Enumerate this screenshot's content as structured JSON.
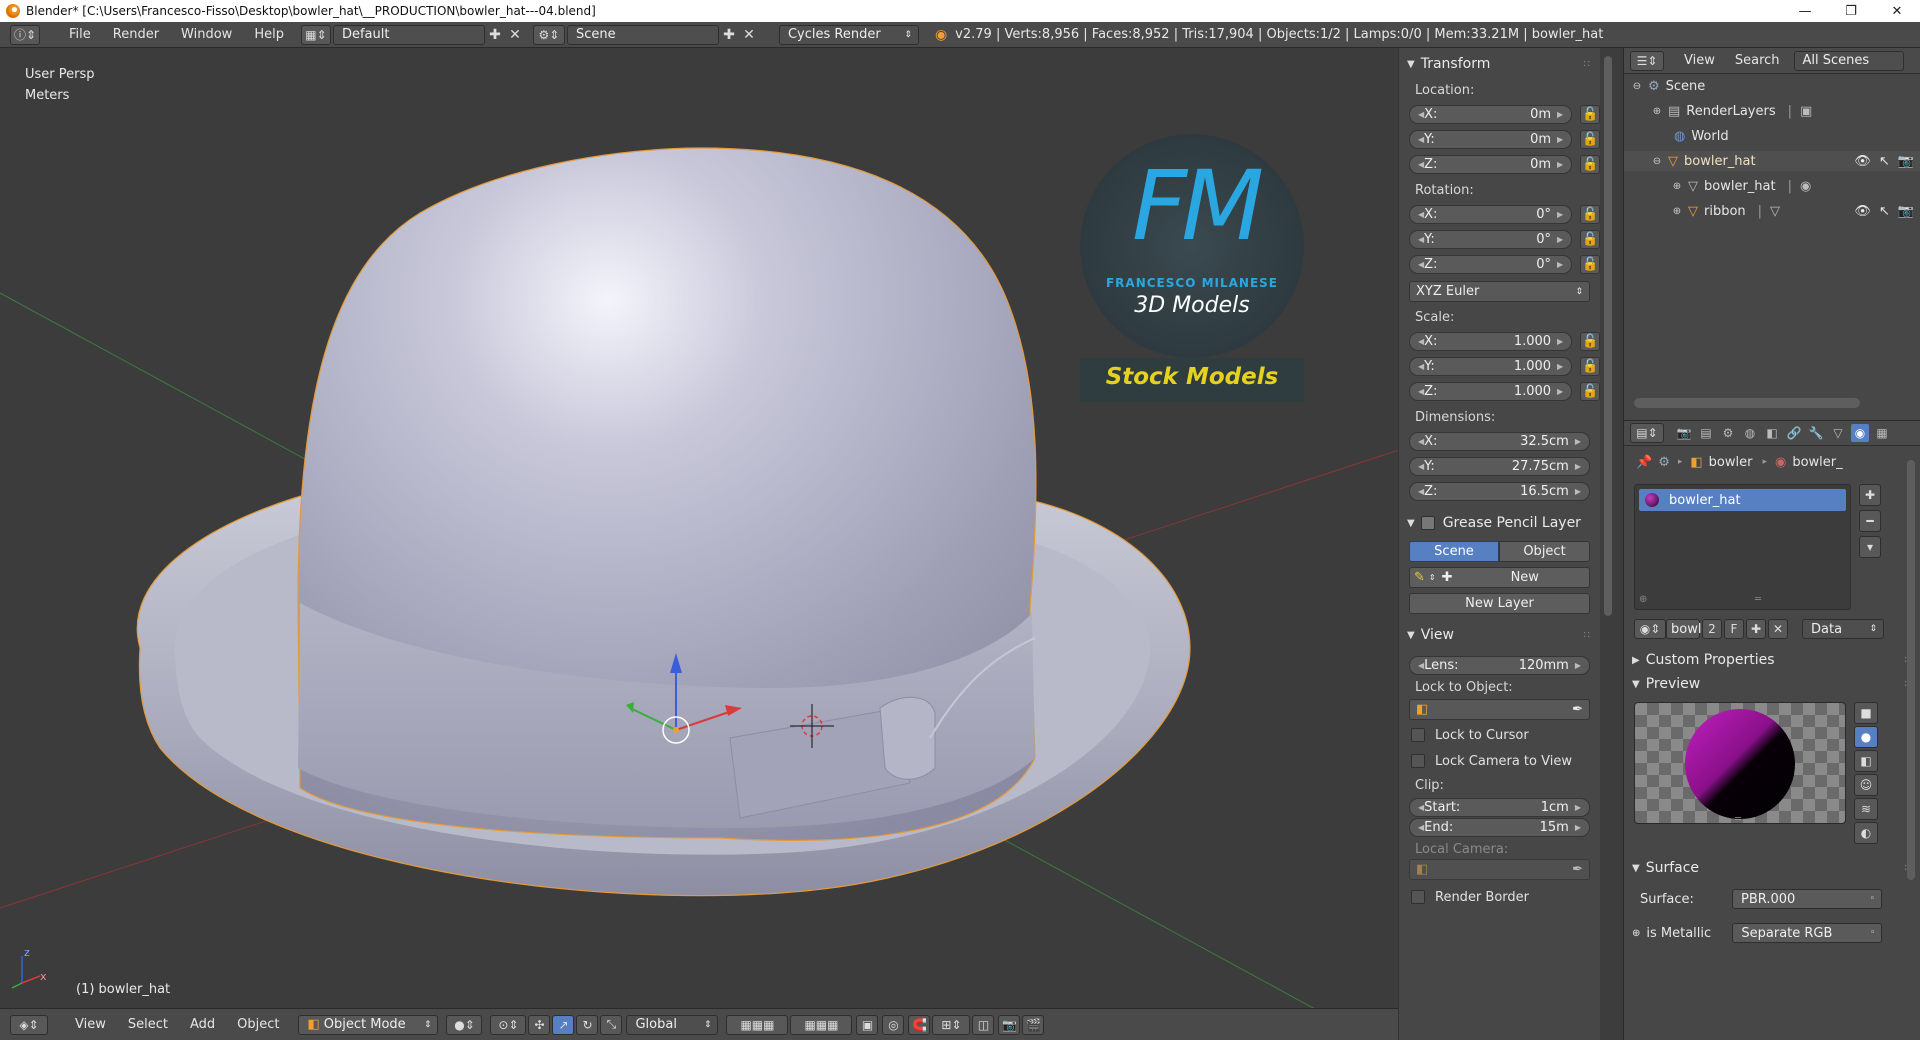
{
  "window": {
    "title": "Blender* [C:\\Users\\Francesco-Fisso\\Desktop\\bowler_hat\\__PRODUCTION\\bowler_hat---04.blend]",
    "minimize": "—",
    "maximize": "❐",
    "close": "✕"
  },
  "topbar": {
    "menus": [
      "File",
      "Render",
      "Window",
      "Help"
    ],
    "screen_layout": "Default",
    "scene": "Scene",
    "render_engine": "Cycles Render",
    "stats": "v2.79 | Verts:8,956 | Faces:8,952 | Tris:17,904 | Objects:1/2 | Lamps:0/0 | Mem:33.21M | bowler_hat"
  },
  "viewport": {
    "view_name": "User Persp",
    "units": "Meters",
    "active_object": "(1) bowler_hat",
    "logo": {
      "initials": "FM",
      "brand": "FRANCESCO MILANESE",
      "subtitle": "3D Models",
      "banner": "Stock Models"
    }
  },
  "viewport_header": {
    "menus": [
      "View",
      "Select",
      "Add",
      "Object"
    ],
    "mode": "Object Mode",
    "orientation": "Global"
  },
  "npanel": {
    "transform": {
      "title": "Transform",
      "location_label": "Location:",
      "location": [
        {
          "axis": "X:",
          "value": "0m"
        },
        {
          "axis": "Y:",
          "value": "0m"
        },
        {
          "axis": "Z:",
          "value": "0m"
        }
      ],
      "rotation_label": "Rotation:",
      "rotation": [
        {
          "axis": "X:",
          "value": "0°"
        },
        {
          "axis": "Y:",
          "value": "0°"
        },
        {
          "axis": "Z:",
          "value": "0°"
        }
      ],
      "rotation_mode": "XYZ Euler",
      "scale_label": "Scale:",
      "scale": [
        {
          "axis": "X:",
          "value": "1.000"
        },
        {
          "axis": "Y:",
          "value": "1.000"
        },
        {
          "axis": "Z:",
          "value": "1.000"
        }
      ],
      "dimensions_label": "Dimensions:",
      "dimensions": [
        {
          "axis": "X:",
          "value": "32.5cm"
        },
        {
          "axis": "Y:",
          "value": "27.75cm"
        },
        {
          "axis": "Z:",
          "value": "16.5cm"
        }
      ]
    },
    "grease_pencil": {
      "title": "Grease Pencil Layer",
      "tab_scene": "Scene",
      "tab_object": "Object",
      "new_label": "New",
      "new_layer_label": "New Layer"
    },
    "view": {
      "title": "View",
      "lens_label": "Lens:",
      "lens_value": "120mm",
      "lock_to_object_label": "Lock to Object:",
      "lock_to_cursor": "Lock to Cursor",
      "lock_camera_to_view": "Lock Camera to View",
      "clip_label": "Clip:",
      "clip_start_label": "Start:",
      "clip_start": "1cm",
      "clip_end_label": "End:",
      "clip_end": "15m",
      "local_camera_label": "Local Camera:",
      "render_border": "Render Border"
    }
  },
  "outliner": {
    "view": "View",
    "search": "Search",
    "filter": "All Scenes",
    "items": [
      {
        "label": "Scene"
      },
      {
        "label": "RenderLayers"
      },
      {
        "label": "World"
      },
      {
        "label": "bowler_hat"
      },
      {
        "label": "bowler_hat"
      },
      {
        "label": "ribbon"
      }
    ]
  },
  "properties": {
    "breadcrumb_object": "bowler",
    "breadcrumb_material": "bowler_",
    "material_slot": "bowler_hat",
    "material_name_short": "bowl",
    "user_count": "2",
    "fake_user": "F",
    "link_mode": "Data",
    "custom_properties": "Custom Properties",
    "preview": "Preview",
    "surface": "Surface",
    "surface_label": "Surface:",
    "surface_value": "PBR.000",
    "is_metallic_label": "is Metallic",
    "is_metallic_value": "Separate RGB"
  },
  "colors": {
    "accent_blue": "#5680c2",
    "selection_orange": "#f0a030",
    "logo_blue": "#2aa7e0",
    "banner_yellow": "#e6d21e"
  }
}
